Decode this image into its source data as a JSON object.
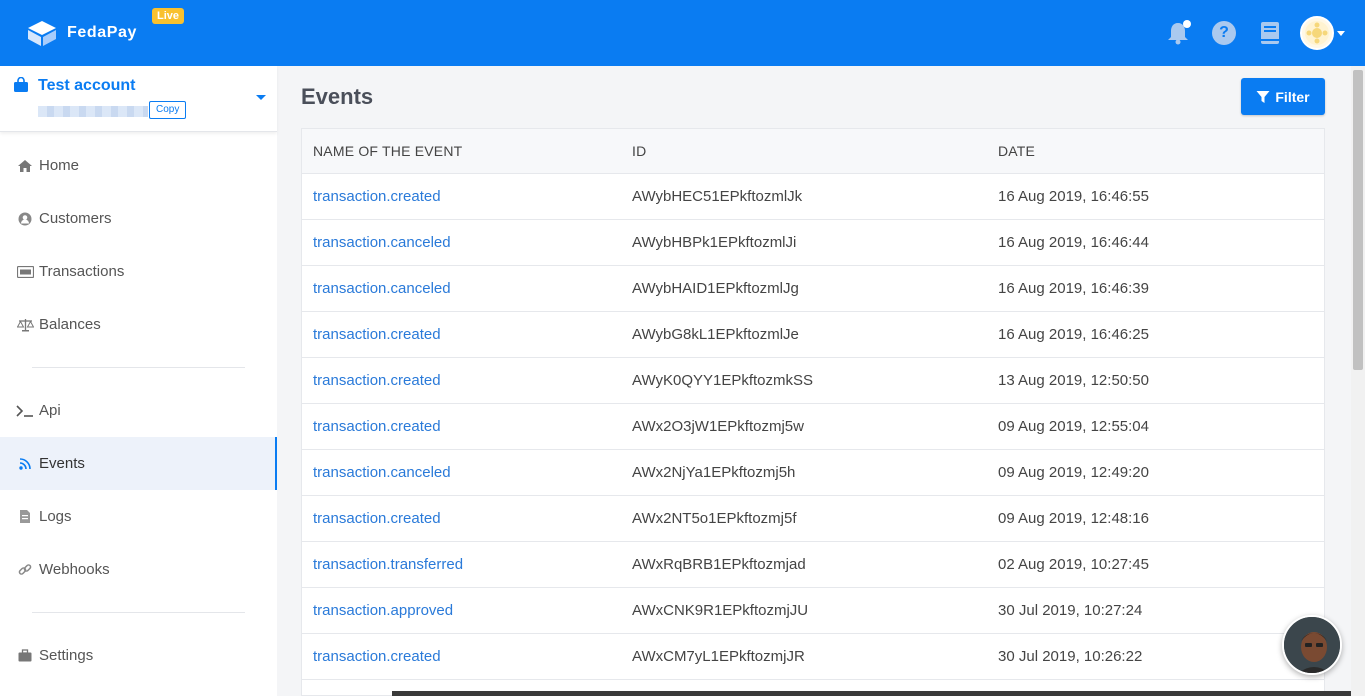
{
  "header": {
    "brand_name": "FedaPay",
    "live_badge": "Live",
    "icons": [
      "bell-icon",
      "help-icon",
      "book-icon",
      "avatar"
    ],
    "help_glyph": "?"
  },
  "account": {
    "name": "Test account",
    "copy_label": "Copy"
  },
  "sidebar": {
    "items": [
      {
        "label": "Home",
        "icon": "home-icon"
      },
      {
        "label": "Customers",
        "icon": "user-icon"
      },
      {
        "label": "Transactions",
        "icon": "card-icon"
      },
      {
        "label": "Balances",
        "icon": "scale-icon"
      },
      {
        "label": "Api",
        "icon": "terminal-icon"
      },
      {
        "label": "Events",
        "icon": "rss-icon",
        "active": true
      },
      {
        "label": "Logs",
        "icon": "file-icon"
      },
      {
        "label": "Webhooks",
        "icon": "link-icon"
      },
      {
        "label": "Settings",
        "icon": "briefcase-icon"
      }
    ]
  },
  "main": {
    "title": "Events",
    "filter_label": "Filter",
    "columns": [
      "NAME OF THE EVENT",
      "ID",
      "DATE"
    ],
    "rows": [
      {
        "name": "transaction.created",
        "id": "AWybHEC51EPkftozmlJk",
        "date": "16 Aug 2019, 16:46:55"
      },
      {
        "name": "transaction.canceled",
        "id": "AWybHBPk1EPkftozmlJi",
        "date": "16 Aug 2019, 16:46:44"
      },
      {
        "name": "transaction.canceled",
        "id": "AWybHAID1EPkftozmlJg",
        "date": "16 Aug 2019, 16:46:39"
      },
      {
        "name": "transaction.created",
        "id": "AWybG8kL1EPkftozmlJe",
        "date": "16 Aug 2019, 16:46:25"
      },
      {
        "name": "transaction.created",
        "id": "AWyK0QYY1EPkftozmkSS",
        "date": "13 Aug 2019, 12:50:50"
      },
      {
        "name": "transaction.created",
        "id": "AWx2O3jW1EPkftozmj5w",
        "date": "09 Aug 2019, 12:55:04"
      },
      {
        "name": "transaction.canceled",
        "id": "AWx2NjYa1EPkftozmj5h",
        "date": "09 Aug 2019, 12:49:20"
      },
      {
        "name": "transaction.created",
        "id": "AWx2NT5o1EPkftozmj5f",
        "date": "09 Aug 2019, 12:48:16"
      },
      {
        "name": "transaction.transferred",
        "id": "AWxRqBRB1EPkftozmjad",
        "date": "02 Aug 2019, 10:27:45"
      },
      {
        "name": "transaction.approved",
        "id": "AWxCNK9R1EPkftozmjJU",
        "date": "30 Jul 2019, 10:27:24"
      },
      {
        "name": "transaction.created",
        "id": "AWxCM7yL1EPkftozmjJR",
        "date": "30 Jul 2019, 10:26:22"
      }
    ]
  },
  "colors": {
    "brand_blue": "#0a7cf2",
    "live_badge": "#f9c12e",
    "link_blue": "#2a7ad9"
  }
}
